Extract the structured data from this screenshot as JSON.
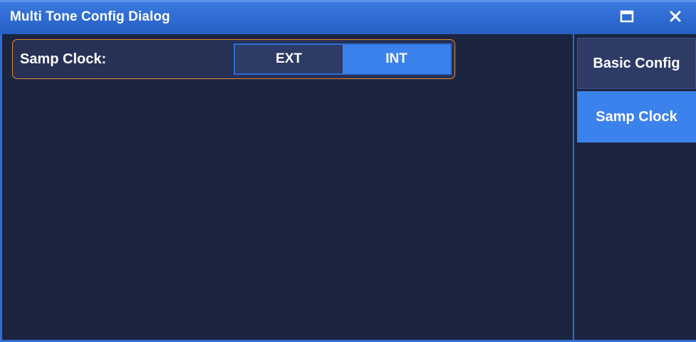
{
  "window": {
    "title": "Multi Tone Config Dialog",
    "maximize_icon": "maximize-icon",
    "close_icon": "close-icon"
  },
  "samp_clock": {
    "label": "Samp Clock:",
    "options": [
      "EXT",
      "INT"
    ],
    "selected": "INT"
  },
  "sidebar": {
    "items": [
      {
        "label": "Basic Config",
        "active": false
      },
      {
        "label": "Samp Clock",
        "active": true
      }
    ]
  },
  "colors": {
    "accent": "#3c82ec",
    "background": "#1c2540",
    "highlight_border": "#e38a2e"
  }
}
